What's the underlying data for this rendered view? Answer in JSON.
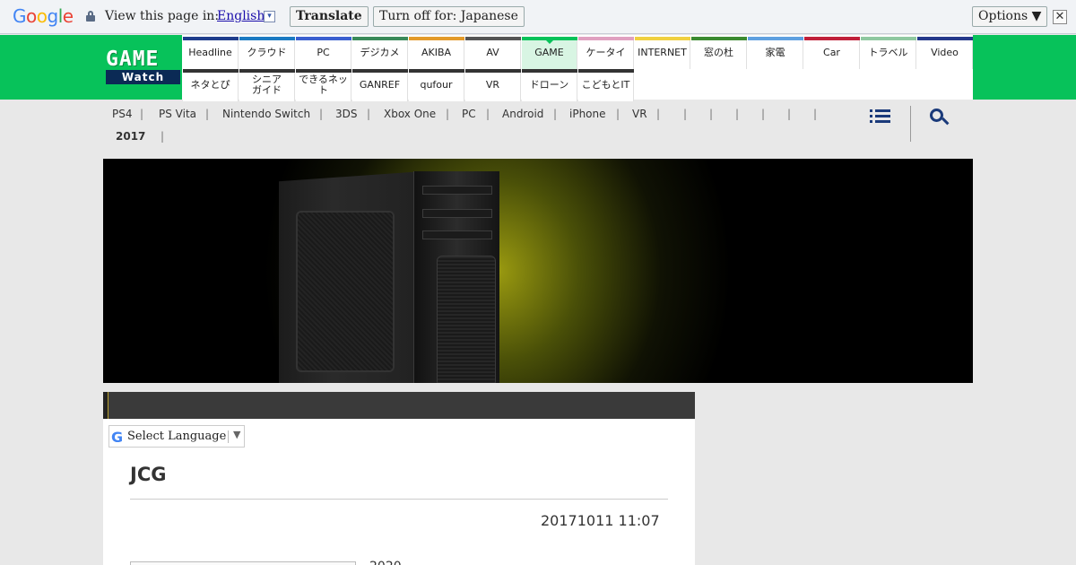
{
  "translate_bar": {
    "logo": [
      "G",
      "o",
      "o",
      "g",
      "l",
      "e"
    ],
    "logo_colors": [
      "#4285f4",
      "#ea4335",
      "#fbbc05",
      "#4285f4",
      "#34a853",
      "#ea4335"
    ],
    "view_text": "View this page in:",
    "language": "English",
    "dropdown_glyph": "▾",
    "translate_label": "Translate",
    "turn_off_label": "Turn off for: Japanese",
    "options_label": "Options ▼",
    "close_glyph": "✕"
  },
  "site_logo": {
    "top": "GAME",
    "bottom": "Watch"
  },
  "nav_row1": [
    {
      "label": "Headline",
      "color": "#1f3d8c"
    },
    {
      "label": "クラウド",
      "color": "#1b7ac2"
    },
    {
      "label": "PC",
      "color": "#3a5fd0"
    },
    {
      "label": "デジカメ",
      "color": "#3a8a5a"
    },
    {
      "label": "AKIBA",
      "color": "#e39a2a"
    },
    {
      "label": "AV",
      "color": "#555555"
    },
    {
      "label": "GAME",
      "color": "#07c25a",
      "active": true
    },
    {
      "label": "ケータイ",
      "color": "#e0a0c0"
    },
    {
      "label": "INTERNET",
      "color": "#f0d040"
    },
    {
      "label": "窓の杜",
      "color": "#3b8a30"
    },
    {
      "label": "家電",
      "color": "#5fa0e0"
    },
    {
      "label": "Car",
      "color": "#c0203a"
    },
    {
      "label": "トラベル",
      "color": "#8fc8a0"
    },
    {
      "label": "Video",
      "color": "#24388a"
    }
  ],
  "nav_row2": [
    {
      "label": "ネタとぴ",
      "color": "#333333"
    },
    {
      "label": "シニア\nガイド",
      "color": "#333333"
    },
    {
      "label": "できるネット",
      "color": "#333333"
    },
    {
      "label": "GANREF",
      "color": "#333333"
    },
    {
      "label": "qufour",
      "color": "#333333"
    },
    {
      "label": "VR",
      "color": "#333333"
    },
    {
      "label": "ドローン",
      "color": "#333333"
    },
    {
      "label": "こどもとIT",
      "color": "#333333"
    }
  ],
  "subnav": [
    "PS4",
    "PS Vita",
    "Nintendo Switch",
    "3DS",
    "Xbox One",
    "PC",
    "Android",
    "iPhone",
    "VR",
    "",
    "",
    "",
    "",
    "",
    ""
  ],
  "subnav_row2": "2017",
  "lang_select": {
    "g": "G",
    "label": "Select Language",
    "arrow": "▼"
  },
  "article": {
    "title": "JCG",
    "date": "20171011 11:07",
    "year_text": "2020"
  }
}
